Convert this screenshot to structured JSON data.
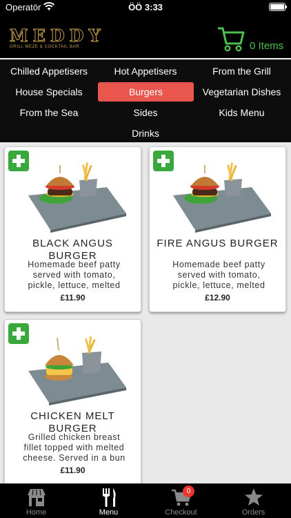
{
  "status_bar": {
    "carrier": "Operatör",
    "time": "ÖÖ 3:33"
  },
  "header": {
    "logo_text": "MEDDY",
    "logo_subtitle": "GRILL MEZE & COCKTAIL BAR",
    "cart_count_label": "0 Items",
    "accent_color": "#4cc04c"
  },
  "categories": [
    {
      "label": "Chilled Appetisers"
    },
    {
      "label": "Hot Appetisers"
    },
    {
      "label": "From the Grill"
    },
    {
      "label": "House Specials"
    },
    {
      "label": "Burgers",
      "selected": true
    },
    {
      "label": "Vegetarian Dishes"
    },
    {
      "label": "From the Sea"
    },
    {
      "label": "Sides"
    },
    {
      "label": "Kids Menu"
    },
    {
      "label": "Drinks"
    }
  ],
  "products": [
    {
      "name": "BLACK ANGUS BURGER",
      "description": "Homemade beef patty served with tomato, pickle, lettuce, melted",
      "price": "£11.90"
    },
    {
      "name": "FIRE ANGUS BURGER",
      "description": "Homemade beef patty served with tomato, pickle, lettuce, melted",
      "price": "£12.90"
    },
    {
      "name": "CHICKEN MELT BURGER",
      "description": "Grilled chicken breast fillet topped with melted cheese. Served in a bun",
      "price": "£11.90"
    }
  ],
  "tabs": [
    {
      "label": "Home",
      "icon": "store-icon"
    },
    {
      "label": "Menu",
      "icon": "fork-knife-icon",
      "active": true
    },
    {
      "label": "Checkout",
      "icon": "cart-icon",
      "badge": "0"
    },
    {
      "label": "Orders",
      "icon": "star-icon"
    }
  ],
  "colors": {
    "active_category": "#e9564e",
    "add_button": "#39a93e",
    "badge": "#e8362c"
  }
}
